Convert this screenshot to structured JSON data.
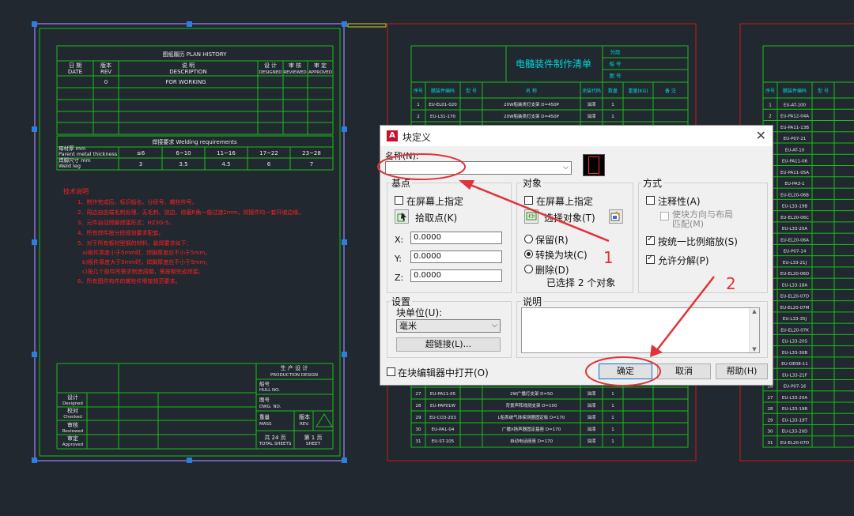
{
  "drawing_left": {
    "plan_history_title": "图纸履历 PLAN HISTORY",
    "col_date": [
      "日 期",
      "DATE"
    ],
    "col_rev": [
      "版本",
      "REV"
    ],
    "col_desc": [
      "说 明",
      "DESCRIPTION"
    ],
    "col_designed": [
      "设 计",
      "DESIGNED"
    ],
    "col_reviewed": [
      "审 核",
      "REVIEWED"
    ],
    "col_approved": [
      "审 定",
      "APPROVED"
    ],
    "row1_rev": "0",
    "row1_desc": "FOR WORKING",
    "weld_title": "焊接要求 Welding requirements",
    "weld_row1_label": [
      "母材厚 mm",
      "Parent metal thickness"
    ],
    "weld_row1": [
      "≤6",
      "6~10",
      "11~16",
      "17~22",
      "23~28"
    ],
    "weld_row2_label": [
      "焊脚尺寸 mm",
      "Weld leg"
    ],
    "weld_row2": [
      "3",
      "3.5",
      "4.5",
      "6",
      "7"
    ],
    "tech_title": "技术说明",
    "tech_notes": [
      "1、制作完成后，标识船名、分段号、螺栓件号。",
      "2、周边自由端毛刺处理，无毛刺、锐边、修磨R角一般过渡2mm，焊接件均一套开坡边缘。",
      "3、元件自动焊脚焊接形式：HZ3G-5。",
      "4、所有焊件按分段规划要求配套。",
      "5、对于所有板材型钢的材料，装焊要求如下：",
      "  a)板件厚度小于5mm时，焊脚厚度应不小于5mm。",
      "  b)板件厚度大于5mm时，焊脚厚度应不小于5mm。",
      "  c)按几个部件所需求制造周期，需按期完成焊接。",
      "6、所有图件构件的螺栓件需按规范要求。"
    ],
    "prod_design": [
      "生 产 设 计",
      "PRODUCTION DESIGN"
    ],
    "hull_no": [
      "船号",
      "HULL NO."
    ],
    "dwg_no": [
      "图号",
      "DWG. NO."
    ],
    "mass": [
      "重量",
      "MASS"
    ],
    "rev": [
      "版本",
      "REV."
    ],
    "designed": [
      "设计",
      "Designed"
    ],
    "checked": [
      "校对",
      "Checked"
    ],
    "reviewed": [
      "审核",
      "Reviewed"
    ],
    "approved": [
      "审定",
      "Approved"
    ],
    "total_sheets": [
      "共 24 页",
      "TOTAL SHEETS"
    ],
    "sheet": [
      "第 1 页",
      "SHEET"
    ]
  },
  "drawing_mid": {
    "title": "电髓装件制作清单",
    "side_labels": [
      "分段",
      "船 号",
      "图 号"
    ],
    "headers": [
      "序号",
      "髓装件编码",
      "型 号",
      "名    称",
      "涂装代码",
      "数量",
      "重量(KG)",
      "备  注"
    ],
    "rows_top": [
      [
        "1",
        "EU-EL01-020",
        "",
        "20W船装类灯支架 D=450P",
        "油漆",
        "1"
      ],
      [
        "2",
        "EU-L31-170",
        "",
        "20W船装类灯支架 D=450P",
        "油漆",
        "1"
      ]
    ],
    "rows_bottom": [
      [
        "27",
        "EU-PA11-05",
        "",
        "2W广播灯支架 D=50",
        "油漆",
        "1"
      ],
      [
        "28",
        "EU-PAP01W",
        "",
        "背景声阵线测支架 D=100",
        "油漆",
        "1"
      ],
      [
        "29",
        "EU-CO3-203",
        "",
        "L船系统气体探测器固定板 D=170",
        "油漆",
        "1"
      ],
      [
        "30",
        "EU-PA1-04",
        "",
        "广播X扬声器固定基座 D=170",
        "油漆",
        "1"
      ],
      [
        "31",
        "EU-ST-105",
        "",
        "自动电话座座 D=170",
        "油漆",
        "1"
      ]
    ]
  },
  "drawing_right": {
    "headers": [
      "序号",
      "髓装件编码",
      "型 号"
    ],
    "rows": [
      [
        "1",
        "EU-AT-100"
      ],
      [
        "2",
        "EU-PA12-04A"
      ],
      [
        "3",
        "EU-PA11-13B"
      ],
      [
        "4",
        "EU-P07-21"
      ],
      [
        "5",
        "EU-AT-10"
      ],
      [
        "6",
        "EU-PA11-06"
      ],
      [
        "7",
        "EU-PA11-05A"
      ],
      [
        "8",
        "EU-PA3-1"
      ],
      [
        "9",
        "EU-EL20-06B"
      ],
      [
        "10",
        "EU-L33-19B"
      ],
      [
        "11",
        "EU-EL20-06C"
      ],
      [
        "12",
        "EU-L33-20A"
      ],
      [
        "13",
        "EU-EL20-06A"
      ],
      [
        "14",
        "EU-P07-14"
      ],
      [
        "15",
        "EU-L33-21J"
      ],
      [
        "16",
        "EU-EL20-06D"
      ],
      [
        "17",
        "EU-L33-18A"
      ],
      [
        "18",
        "EU-EL20-07D"
      ],
      [
        "19",
        "EU-EL20-07M"
      ],
      [
        "20",
        "EU-L33-35J"
      ],
      [
        "21",
        "EU-EL20-07K"
      ],
      [
        "22",
        "EU-L33-20S"
      ],
      [
        "23",
        "EU-L33-30B"
      ],
      [
        "24",
        "EU-OE08-11"
      ],
      [
        "25",
        "EU-L33-21F"
      ],
      [
        "26",
        "EU-P07-16"
      ],
      [
        "27",
        "EU-L33-20A"
      ],
      [
        "28",
        "EU-L33-19B"
      ],
      [
        "29",
        "EU-L33-19T"
      ],
      [
        "30",
        "EU-L33-20D"
      ],
      [
        "31",
        "EU-EL20-07D"
      ]
    ]
  },
  "dialog": {
    "title": "块定义",
    "name_label": "名称(N):",
    "name_value": "",
    "base_group": "基点",
    "base_onscreen": "在屏幕上指定",
    "base_pick": "拾取点(K)",
    "x_label": "X:",
    "x_value": "0.0000",
    "y_label": "Y:",
    "y_value": "0.0000",
    "z_label": "Z:",
    "z_value": "0.0000",
    "obj_group": "对象",
    "obj_onscreen": "在屏幕上指定",
    "obj_select": "选择对象(T)",
    "obj_retain": "保留(R)",
    "obj_convert": "转换为块(C)",
    "obj_delete": "删除(D)",
    "obj_selected": "已选择 2 个对象",
    "method_group": "方式",
    "annotative": "注释性(A)",
    "match_orient": "使块方向与布局匹配(M)",
    "uniform_scale": "按统一比例缩放(S)",
    "allow_explode": "允许分解(P)",
    "settings_group": "设置",
    "block_unit_label": "块单位(U):",
    "block_unit_value": "毫米",
    "hyperlink": "超链接(L)...",
    "desc_group": "说明",
    "open_in_editor": "在块编辑器中打开(O)",
    "ok": "确定",
    "cancel": "取消",
    "help": "帮助(H)"
  },
  "annotations": {
    "label1": "1",
    "label2": "2",
    "color": "#e0333a"
  }
}
